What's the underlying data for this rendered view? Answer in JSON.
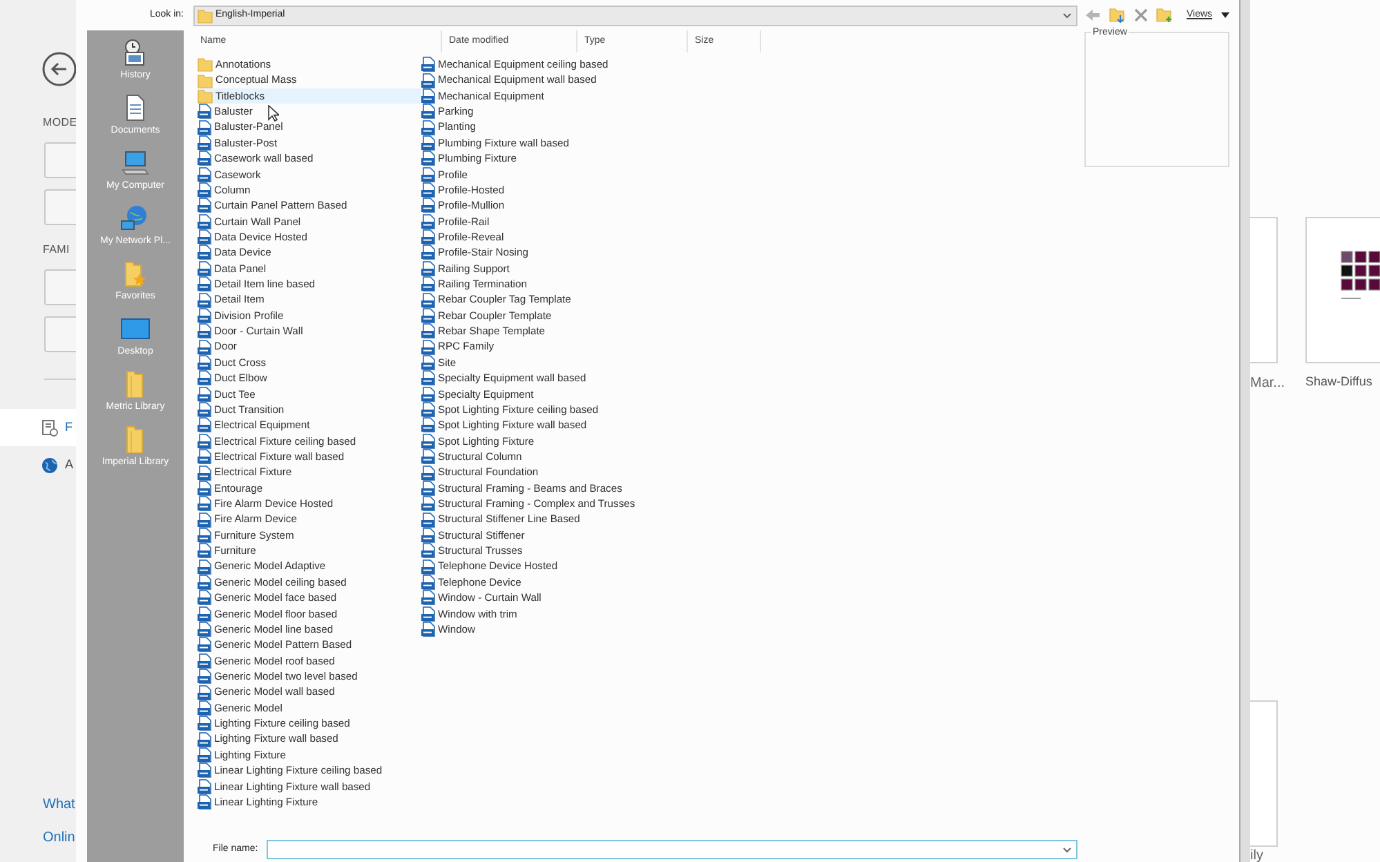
{
  "background_app": {
    "section_labels": [
      "MODE",
      "FAMI"
    ],
    "sidebar_items": [
      {
        "label": "F",
        "selected": true,
        "kind": "recent"
      },
      {
        "label": "A",
        "selected": false,
        "kind": "globe"
      }
    ],
    "links": [
      "What",
      "Onlin"
    ],
    "cards": [
      {
        "label": "Mar..."
      },
      {
        "label": "Shaw-Diffus"
      },
      {
        "label": "ily"
      }
    ]
  },
  "dialog": {
    "look_in_label": "Look in:",
    "look_in_value": "English-Imperial",
    "views_label": "Views",
    "preview_label": "Preview",
    "places": [
      {
        "label": "History",
        "kind": "history"
      },
      {
        "label": "Documents",
        "kind": "documents"
      },
      {
        "label": "My Computer",
        "kind": "computer"
      },
      {
        "label": "My Network Pl...",
        "kind": "network"
      },
      {
        "label": "Favorites",
        "kind": "favorites"
      },
      {
        "label": "Desktop",
        "kind": "desktop"
      },
      {
        "label": "Metric Library",
        "kind": "folder"
      },
      {
        "label": "Imperial Library",
        "kind": "folder"
      }
    ],
    "columns": [
      "Name",
      "Date modified",
      "Type",
      "Size"
    ],
    "files": [
      {
        "name": "Annotations",
        "kind": "folder",
        "hovered": false
      },
      {
        "name": "Conceptual Mass",
        "kind": "folder",
        "hovered": false
      },
      {
        "name": "Titleblocks",
        "kind": "folder",
        "hovered": true
      },
      {
        "name": "Baluster",
        "kind": "family",
        "hovered": false
      },
      {
        "name": "Baluster-Panel",
        "kind": "family",
        "hovered": false
      },
      {
        "name": "Baluster-Post",
        "kind": "family",
        "hovered": false
      },
      {
        "name": "Casework wall based",
        "kind": "family",
        "hovered": false
      },
      {
        "name": "Casework",
        "kind": "family",
        "hovered": false
      },
      {
        "name": "Column",
        "kind": "family",
        "hovered": false
      },
      {
        "name": "Curtain Panel Pattern Based",
        "kind": "family",
        "hovered": false
      },
      {
        "name": "Curtain Wall Panel",
        "kind": "family",
        "hovered": false
      },
      {
        "name": "Data Device Hosted",
        "kind": "family",
        "hovered": false
      },
      {
        "name": "Data Device",
        "kind": "family",
        "hovered": false
      },
      {
        "name": "Data Panel",
        "kind": "family",
        "hovered": false
      },
      {
        "name": "Detail Item line based",
        "kind": "family",
        "hovered": false
      },
      {
        "name": "Detail Item",
        "kind": "family",
        "hovered": false
      },
      {
        "name": "Division Profile",
        "kind": "family",
        "hovered": false
      },
      {
        "name": "Door - Curtain Wall",
        "kind": "family",
        "hovered": false
      },
      {
        "name": "Door",
        "kind": "family",
        "hovered": false
      },
      {
        "name": "Duct Cross",
        "kind": "family",
        "hovered": false
      },
      {
        "name": "Duct Elbow",
        "kind": "family",
        "hovered": false
      },
      {
        "name": "Duct Tee",
        "kind": "family",
        "hovered": false
      },
      {
        "name": "Duct Transition",
        "kind": "family",
        "hovered": false
      },
      {
        "name": "Electrical Equipment",
        "kind": "family",
        "hovered": false
      },
      {
        "name": "Electrical Fixture ceiling based",
        "kind": "family",
        "hovered": false
      },
      {
        "name": "Electrical Fixture wall based",
        "kind": "family",
        "hovered": false
      },
      {
        "name": "Electrical Fixture",
        "kind": "family",
        "hovered": false
      },
      {
        "name": "Entourage",
        "kind": "family",
        "hovered": false
      },
      {
        "name": "Fire Alarm Device Hosted",
        "kind": "family",
        "hovered": false
      },
      {
        "name": "Fire Alarm Device",
        "kind": "family",
        "hovered": false
      },
      {
        "name": "Furniture System",
        "kind": "family",
        "hovered": false
      },
      {
        "name": "Furniture",
        "kind": "family",
        "hovered": false
      },
      {
        "name": "Generic Model Adaptive",
        "kind": "family",
        "hovered": false
      },
      {
        "name": "Generic Model ceiling based",
        "kind": "family",
        "hovered": false
      },
      {
        "name": "Generic Model face based",
        "kind": "family",
        "hovered": false
      },
      {
        "name": "Generic Model floor based",
        "kind": "family",
        "hovered": false
      },
      {
        "name": "Generic Model line based",
        "kind": "family",
        "hovered": false
      },
      {
        "name": "Generic Model Pattern Based",
        "kind": "family",
        "hovered": false
      },
      {
        "name": "Generic Model roof based",
        "kind": "family",
        "hovered": false
      },
      {
        "name": "Generic Model two level based",
        "kind": "family",
        "hovered": false
      },
      {
        "name": "Generic Model wall based",
        "kind": "family",
        "hovered": false
      },
      {
        "name": "Generic Model",
        "kind": "family",
        "hovered": false
      },
      {
        "name": "Lighting Fixture ceiling based",
        "kind": "family",
        "hovered": false
      },
      {
        "name": "Lighting Fixture wall based",
        "kind": "family",
        "hovered": false
      },
      {
        "name": "Lighting Fixture",
        "kind": "family",
        "hovered": false
      },
      {
        "name": "Linear Lighting Fixture ceiling based",
        "kind": "family",
        "hovered": false
      },
      {
        "name": "Linear Lighting Fixture wall based",
        "kind": "family",
        "hovered": false
      },
      {
        "name": "Linear Lighting Fixture",
        "kind": "family",
        "hovered": false
      },
      {
        "name": "Mechanical Equipment ceiling based",
        "kind": "family",
        "hovered": false
      },
      {
        "name": "Mechanical Equipment wall based",
        "kind": "family",
        "hovered": false
      },
      {
        "name": "Mechanical Equipment",
        "kind": "family",
        "hovered": false
      },
      {
        "name": "Parking",
        "kind": "family",
        "hovered": false
      },
      {
        "name": "Planting",
        "kind": "family",
        "hovered": false
      },
      {
        "name": "Plumbing Fixture wall based",
        "kind": "family",
        "hovered": false
      },
      {
        "name": "Plumbing Fixture",
        "kind": "family",
        "hovered": false
      },
      {
        "name": "Profile",
        "kind": "family",
        "hovered": false
      },
      {
        "name": "Profile-Hosted",
        "kind": "family",
        "hovered": false
      },
      {
        "name": "Profile-Mullion",
        "kind": "family",
        "hovered": false
      },
      {
        "name": "Profile-Rail",
        "kind": "family",
        "hovered": false
      },
      {
        "name": "Profile-Reveal",
        "kind": "family",
        "hovered": false
      },
      {
        "name": "Profile-Stair Nosing",
        "kind": "family",
        "hovered": false
      },
      {
        "name": "Railing Support",
        "kind": "family",
        "hovered": false
      },
      {
        "name": "Railing Termination",
        "kind": "family",
        "hovered": false
      },
      {
        "name": "Rebar Coupler Tag Template",
        "kind": "family",
        "hovered": false
      },
      {
        "name": "Rebar Coupler Template",
        "kind": "family",
        "hovered": false
      },
      {
        "name": "Rebar Shape Template",
        "kind": "family",
        "hovered": false
      },
      {
        "name": "RPC Family",
        "kind": "family",
        "hovered": false
      },
      {
        "name": "Site",
        "kind": "family",
        "hovered": false
      },
      {
        "name": "Specialty Equipment wall based",
        "kind": "family",
        "hovered": false
      },
      {
        "name": "Specialty Equipment",
        "kind": "family",
        "hovered": false
      },
      {
        "name": "Spot Lighting Fixture ceiling based",
        "kind": "family",
        "hovered": false
      },
      {
        "name": "Spot Lighting Fixture wall based",
        "kind": "family",
        "hovered": false
      },
      {
        "name": "Spot Lighting Fixture",
        "kind": "family",
        "hovered": false
      },
      {
        "name": "Structural Column",
        "kind": "family",
        "hovered": false
      },
      {
        "name": "Structural Foundation",
        "kind": "family",
        "hovered": false
      },
      {
        "name": "Structural Framing - Beams and Braces",
        "kind": "family",
        "hovered": false
      },
      {
        "name": "Structural Framing - Complex and Trusses",
        "kind": "family",
        "hovered": false
      },
      {
        "name": "Structural Stiffener Line Based",
        "kind": "family",
        "hovered": false
      },
      {
        "name": "Structural Stiffener",
        "kind": "family",
        "hovered": false
      },
      {
        "name": "Structural Trusses",
        "kind": "family",
        "hovered": false
      },
      {
        "name": "Telephone Device Hosted",
        "kind": "family",
        "hovered": false
      },
      {
        "name": "Telephone Device",
        "kind": "family",
        "hovered": false
      },
      {
        "name": "Window - Curtain Wall",
        "kind": "family",
        "hovered": false
      },
      {
        "name": "Window with trim",
        "kind": "family",
        "hovered": false
      },
      {
        "name": "Window",
        "kind": "family",
        "hovered": false
      }
    ],
    "file_name_label": "File name:"
  }
}
